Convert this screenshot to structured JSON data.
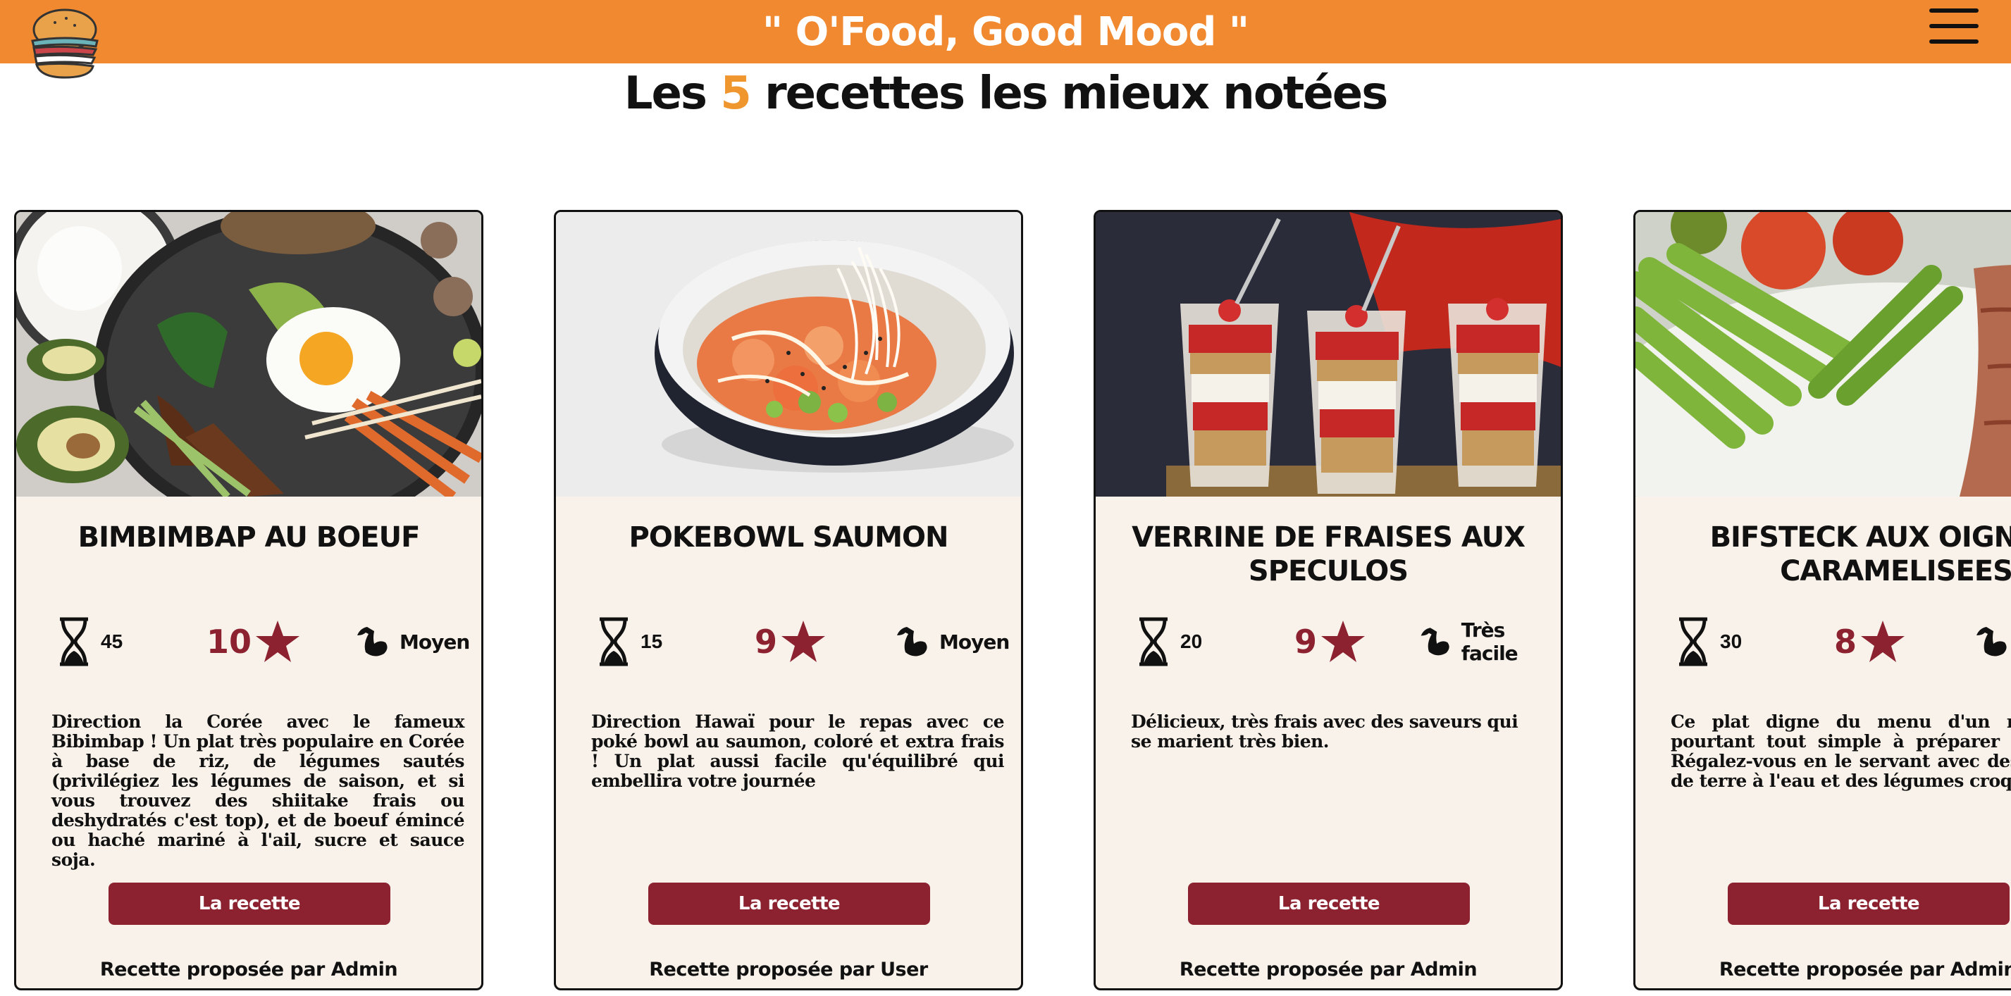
{
  "header": {
    "title": "\" O'Food, Good Mood \"",
    "logo_icon": "burger-logo-icon",
    "menu_icon": "hamburger-menu-icon",
    "bar_color": "#f0892f"
  },
  "section": {
    "heading_prefix": "Les ",
    "heading_number": "5",
    "heading_suffix": " recettes les mieux notées",
    "accent_color": "#f0962f"
  },
  "recipes": [
    {
      "title": "BIMBIMBAP AU BOEUF",
      "time": "45",
      "rating": "10",
      "difficulty": "Moyen",
      "description": "Direction la Corée avec le fameux Bibimbap ! Un plat très populaire en Corée à base de riz, de légumes sautés (privilégiez les légumes de saison, et si vous trouvez des shiitake frais ou deshydratés c'est top), et de boeuf émincé ou haché mariné à l'ail, sucre et sauce soja.",
      "button_label": "La recette",
      "author": "Recette proposée par Admin",
      "image": "bibimbap-photo"
    },
    {
      "title": "POKEBOWL SAUMON",
      "time": "15",
      "rating": "9",
      "difficulty": "Moyen",
      "description": "Direction Hawaï pour le repas avec ce poké bowl au saumon, coloré et extra frais ! Un plat aussi facile qu'équilibré qui embellira votre journée",
      "button_label": "La recette",
      "author": "Recette proposée par User",
      "image": "pokebowl-photo"
    },
    {
      "title": "VERRINE DE FRAISES AUX SPECULOS",
      "time": "20",
      "rating": "9",
      "difficulty": "Très facile",
      "description": "Délicieux, très frais avec des saveurs qui se marient très bien.",
      "button_label": "La recette",
      "author": "Recette proposée par Admin",
      "image": "verrine-photo"
    },
    {
      "title": "BIFSTECK AUX OIGNONS CARAMELISEES",
      "time": "30",
      "rating": "8",
      "difficulty": "",
      "description": "Ce plat digne du menu d'un restaurant pourtant tout simple à préparer et sûr de Régalez-vous en le servant avec des pommes de terre à l'eau et des légumes croquants !",
      "button_label": "La recette",
      "author": "Recette proposée par Admin",
      "image": "bifsteck-photo"
    }
  ],
  "colors": {
    "card_bg": "#f9f2ea",
    "button": "#8c2230",
    "rating": "#8c2230"
  }
}
